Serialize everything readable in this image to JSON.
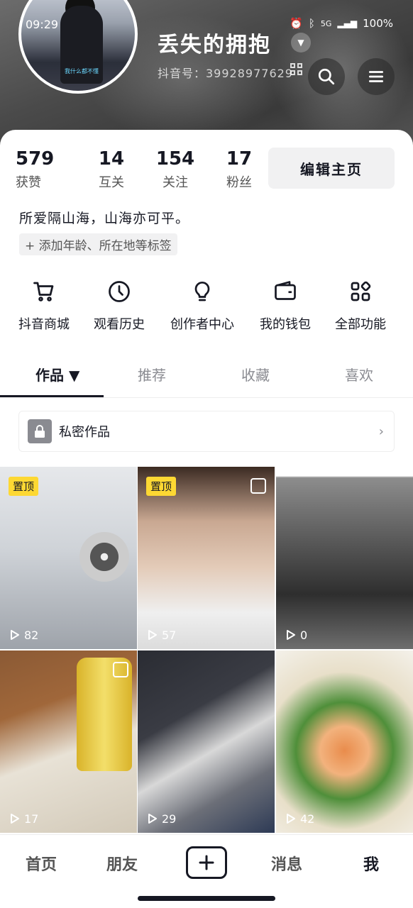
{
  "status_bar": {
    "time": "09:29",
    "network": "5G",
    "battery": "100%"
  },
  "profile": {
    "nickname": "丢失的拥抱",
    "douyin_id": "抖音号：39928977629",
    "avatar_caption": "我什么都不懂"
  },
  "stats": [
    {
      "value": "579",
      "label": "获赞"
    },
    {
      "value": "14",
      "label": "互关"
    },
    {
      "value": "154",
      "label": "关注"
    },
    {
      "value": "17",
      "label": "粉丝"
    }
  ],
  "edit_button": "编辑主页",
  "bio": "所爱隔山海，山海亦可平。",
  "add_tag": "+ 添加年龄、所在地等标签",
  "shortcuts": [
    {
      "label": "抖音商城",
      "icon": "cart-icon"
    },
    {
      "label": "观看历史",
      "icon": "clock-icon"
    },
    {
      "label": "创作者中心",
      "icon": "bulb-icon"
    },
    {
      "label": "我的钱包",
      "icon": "wallet-icon"
    },
    {
      "label": "全部功能",
      "icon": "grid-icon"
    }
  ],
  "tabs": [
    {
      "label": "作品 ▼"
    },
    {
      "label": "推荐"
    },
    {
      "label": "收藏"
    },
    {
      "label": "喜欢"
    }
  ],
  "private_works": "私密作品",
  "videos": [
    {
      "pinned": "置顶",
      "plays": "82",
      "theme": "#cfd3d8"
    },
    {
      "pinned": "置顶",
      "plays": "57",
      "theme": "#9a8a80"
    },
    {
      "pinned": "",
      "plays": "0",
      "theme": "#4a4a4a"
    },
    {
      "pinned": "",
      "plays": "17",
      "theme": "#b9b1a4"
    },
    {
      "pinned": "",
      "plays": "29",
      "theme": "#3a3c44"
    },
    {
      "pinned": "",
      "plays": "42",
      "theme": "#d9c6a4"
    }
  ],
  "bottom_nav": {
    "home": "首页",
    "friends": "朋友",
    "messages": "消息",
    "me": "我"
  }
}
